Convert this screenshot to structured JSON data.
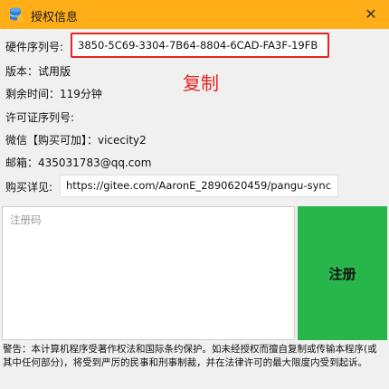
{
  "window": {
    "title": "授权信息",
    "close_glyph": "✕"
  },
  "serial": {
    "label": "硬件序列号:",
    "value": "3850-5C69-3304-7B64-8804-6CAD-FA3F-19FB",
    "copy_label": "复制"
  },
  "version": {
    "label": "版本：试用版"
  },
  "remaining": {
    "label": "剩余时间：119分钟"
  },
  "license": {
    "label": "许可证序列号:"
  },
  "wechat": {
    "label": "微信【购买可加】：vicecity2"
  },
  "email": {
    "label": "邮箱：435031783@qq.com"
  },
  "purchase": {
    "label": "购买详见:",
    "url": "https://gitee.com/AaronE_2890620459/pangu-sync"
  },
  "register": {
    "placeholder": "注册码",
    "button_label": "注册"
  },
  "warning_text": "警告：本计算机程序受著作权法和国际条约保护。如未经授权而擅自复制或传输本程序(或其中任何部分)，将受到严厉的民事和刑事制裁，并在法律许可的最大限度内受到起诉。",
  "colors": {
    "titlebar": "#ffae17",
    "highlight": "#e8231d",
    "register_button": "#28b64b"
  }
}
